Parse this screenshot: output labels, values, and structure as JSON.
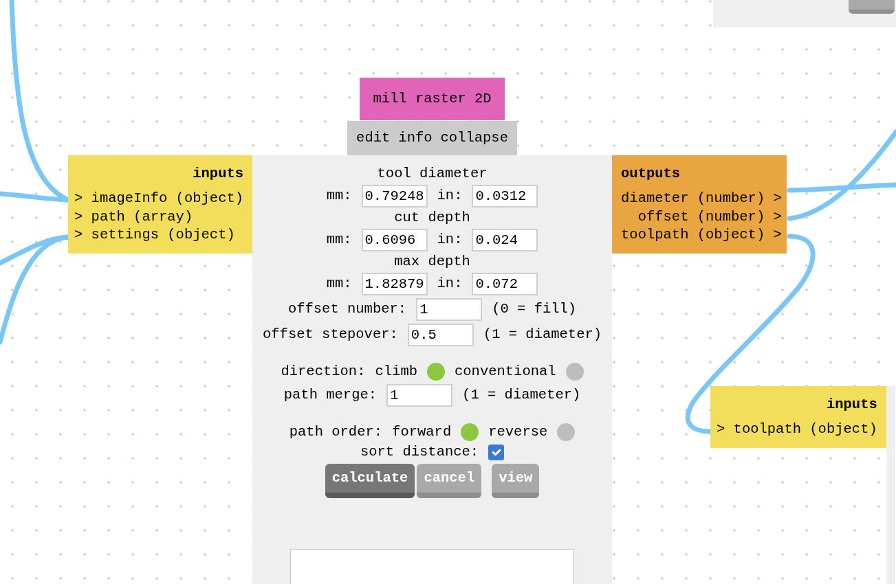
{
  "nodes": [
    {
      "title": "mill raster 2D",
      "menu": [
        "edit",
        "info",
        "collapse"
      ],
      "inputs": {
        "title": "inputs",
        "ports": [
          "> imageInfo (object)",
          "> path (array)",
          "> settings (object)"
        ]
      },
      "outputs": {
        "title": "outputs",
        "ports": [
          "diameter (number) >",
          "offset (number) >",
          "toolpath (object) >"
        ]
      },
      "sections": [
        [
          {
            "kind": "heading",
            "text": "tool diameter"
          },
          {
            "kind": "units",
            "fields": [
              {
                "label": "mm:",
                "value": "0.79248"
              },
              {
                "label": "in:",
                "value": "0.0312"
              }
            ]
          },
          {
            "kind": "heading",
            "text": "cut depth"
          },
          {
            "kind": "units",
            "fields": [
              {
                "label": "mm:",
                "value": "0.6096"
              },
              {
                "label": "in:",
                "value": "0.024"
              }
            ]
          },
          {
            "kind": "heading",
            "text": "max depth"
          },
          {
            "kind": "units",
            "fields": [
              {
                "label": "mm:",
                "value": "1.82879"
              },
              {
                "label": "in:",
                "value": "0.072"
              }
            ]
          },
          {
            "kind": "field",
            "label": "offset number:",
            "value": "1",
            "note": "(0 = fill)"
          },
          {
            "kind": "field",
            "label": "offset stepover:",
            "value": "0.5",
            "note": "(1 = diameter)"
          }
        ],
        [
          {
            "kind": "radio",
            "label": "direction:",
            "options": [
              {
                "label": "climb",
                "selected": true
              },
              {
                "label": "conventional",
                "selected": false
              }
            ]
          },
          {
            "kind": "field",
            "label": "path merge:",
            "value": "1",
            "note": "(1 = diameter)"
          }
        ],
        [
          {
            "kind": "radio",
            "label": "path order:",
            "options": [
              {
                "label": "forward",
                "selected": true
              },
              {
                "label": "reverse",
                "selected": false
              }
            ]
          },
          {
            "kind": "checkbox",
            "label": "sort distance:",
            "checked": true
          },
          {
            "kind": "buttons",
            "buttons": [
              {
                "label": "calculate",
                "hovered": true
              },
              {
                "label": "cancel",
                "hovered": false
              },
              {
                "label": "view",
                "hovered": false
              }
            ]
          }
        ]
      ]
    },
    {
      "inputs": {
        "title": "inputs",
        "ports": [
          "> toolpath (object)"
        ]
      }
    }
  ]
}
